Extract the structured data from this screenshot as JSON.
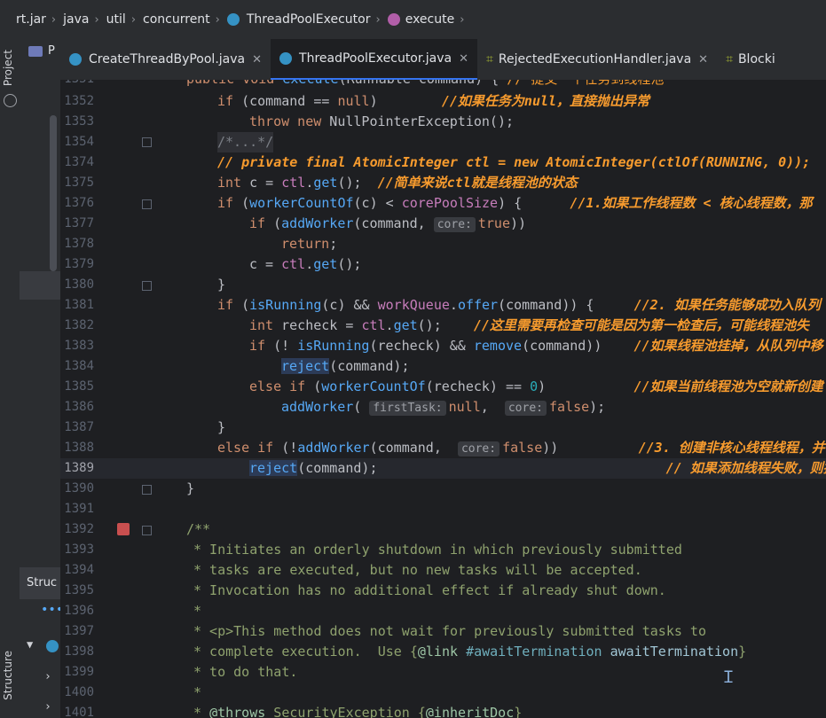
{
  "breadcrumb": [
    "rt.jar",
    "java",
    "util",
    "concurrent",
    "ThreadPoolExecutor",
    "execute"
  ],
  "tool_windows": {
    "project": "Project",
    "structure": "Structure",
    "structure_tab": "Struc",
    "project_tab": "P"
  },
  "tabs": [
    {
      "label": "CreateThreadByPool.java",
      "icon": "class-icon",
      "active": false
    },
    {
      "label": "ThreadPoolExecutor.java",
      "icon": "class-icon",
      "active": true
    },
    {
      "label": "RejectedExecutionHandler.java",
      "icon": "interface-icon",
      "active": false
    },
    {
      "label": "Blocki",
      "icon": "interface-icon",
      "active": false
    }
  ],
  "lines": [
    {
      "n": "1351",
      "t": "public void execute(Runnable command) { // 提交一个任务到线程池"
    },
    {
      "n": "1352",
      "t": "if (command == null)        //如果任务为null，直接抛出异常"
    },
    {
      "n": "1353",
      "t": "throw new NullPointerException();"
    },
    {
      "n": "1354",
      "t": "/*...*/"
    },
    {
      "n": "1374",
      "t": "// private final AtomicInteger ctl = new AtomicInteger(ctlOf(RUNNING, 0));"
    },
    {
      "n": "1375",
      "t": "int c = ctl.get();  //简单来说ctl就是线程池的状态"
    },
    {
      "n": "1376",
      "t": "if (workerCountOf(c) < corePoolSize) {      //1.如果工作线程数 < 核心线程数，那"
    },
    {
      "n": "1377",
      "t": "if (addWorker(command, core: true))"
    },
    {
      "n": "1378",
      "t": "return;"
    },
    {
      "n": "1379",
      "t": "c = ctl.get();"
    },
    {
      "n": "1380",
      "t": "}"
    },
    {
      "n": "1381",
      "t": "if (isRunning(c) && workQueue.offer(command)) {     //2. 如果任务能够成功入队列"
    },
    {
      "n": "1382",
      "t": "int recheck = ctl.get();    //这里需要再检查可能是因为第一检查后，可能线程池失"
    },
    {
      "n": "1383",
      "t": "if (! isRunning(recheck) && remove(command))    //如果线程池挂掉，从队列中移"
    },
    {
      "n": "1384",
      "t": "reject(command);"
    },
    {
      "n": "1385",
      "t": "else if (workerCountOf(recheck) == 0)           //如果当前线程池为空就新创建"
    },
    {
      "n": "1386",
      "t": "addWorker( firstTask: null,  core: false);"
    },
    {
      "n": "1387",
      "t": "}"
    },
    {
      "n": "1388",
      "t": "else if (!addWorker(command,  core: false))          //3. 创建非核心线程线程，并"
    },
    {
      "n": "1389",
      "t": "reject(command);                                    // 如果添加线程失败，则执行"
    },
    {
      "n": "1390",
      "t": "}"
    },
    {
      "n": "1391",
      "t": ""
    },
    {
      "n": "1392",
      "t": "/**"
    },
    {
      "n": "1393",
      "t": "* Initiates an orderly shutdown in which previously submitted"
    },
    {
      "n": "1394",
      "t": "* tasks are executed, but no new tasks will be accepted."
    },
    {
      "n": "1395",
      "t": "* Invocation has no additional effect if already shut down."
    },
    {
      "n": "1396",
      "t": "*"
    },
    {
      "n": "1397",
      "t": "* <p>This method does not wait for previously submitted tasks to"
    },
    {
      "n": "1398",
      "t": "* complete execution.  Use {@link #awaitTermination awaitTermination}"
    },
    {
      "n": "1399",
      "t": "* to do that."
    },
    {
      "n": "1400",
      "t": "*"
    },
    {
      "n": "1401",
      "t": "* @throws SecurityException {@inheritDoc}"
    }
  ]
}
